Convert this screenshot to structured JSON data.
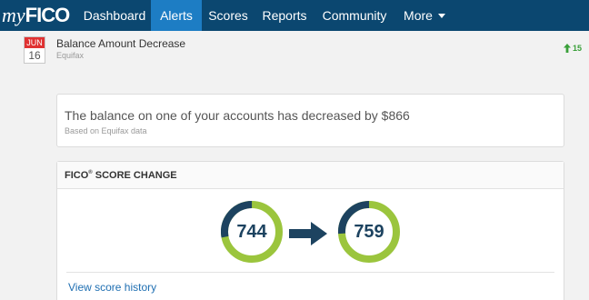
{
  "nav": {
    "logo_my": "my",
    "logo_fico": "FICO",
    "items": [
      {
        "label": "Dashboard",
        "active": false
      },
      {
        "label": "Alerts",
        "active": true
      },
      {
        "label": "Scores",
        "active": false
      },
      {
        "label": "Reports",
        "active": false
      },
      {
        "label": "Community",
        "active": false
      },
      {
        "label": "More",
        "active": false
      }
    ]
  },
  "alert": {
    "month": "JUN",
    "day": "16",
    "title": "Balance Amount Decrease",
    "source": "Equifax",
    "change": "15",
    "change_direction": "up",
    "change_color": "#3aa03a"
  },
  "message": {
    "text": "The balance on one of your accounts has decreased by $866",
    "sub": "Based on Equifax data"
  },
  "score_change": {
    "header": "FICO",
    "header_mark": "®",
    "header_rest": " SCORE CHANGE",
    "old_score": "744",
    "new_score": "759",
    "old_fraction": 0.72,
    "new_fraction": 0.74,
    "ring_color": "#9bc53d",
    "ring_dark_color": "#1d4360",
    "arrow_icon": "right-arrow-icon",
    "link": "View score history"
  },
  "colors": {
    "nav_bg": "#0b4770",
    "nav_active": "#1d7dc4",
    "badge_red": "#e03232",
    "link_blue": "#1f6fb2"
  }
}
